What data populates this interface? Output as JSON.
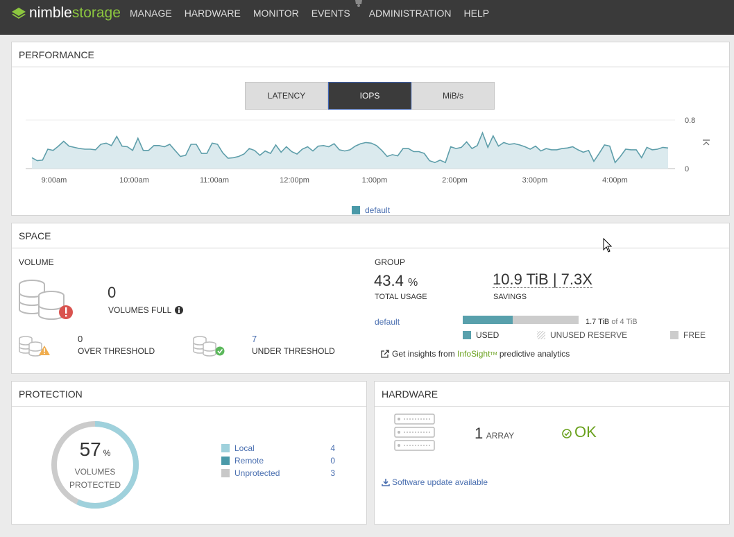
{
  "app": {
    "brand_a": "nimble",
    "brand_b": "storage"
  },
  "nav": [
    "MANAGE",
    "HARDWARE",
    "MONITOR",
    "EVENTS",
    "ADMINISTRATION",
    "HELP"
  ],
  "performance": {
    "title": "PERFORMANCE",
    "tabs": [
      "LATENCY",
      "IOPS",
      "MiB/s"
    ],
    "active_tab": "IOPS",
    "legend": "default",
    "chart_data": {
      "type": "area",
      "x_ticks": [
        "9:00am",
        "10:00am",
        "11:00am",
        "12:00pm",
        "1:00pm",
        "2:00pm",
        "3:00pm",
        "4:00pm"
      ],
      "y_ticks": [
        "0.8",
        "0"
      ],
      "ylim": [
        0,
        0.8
      ],
      "series": [
        {
          "name": "default",
          "color": "#5e9eaa",
          "values": [
            0.18,
            0.13,
            0.14,
            0.32,
            0.3,
            0.37,
            0.45,
            0.37,
            0.35,
            0.33,
            0.32,
            0.32,
            0.31,
            0.4,
            0.42,
            0.38,
            0.53,
            0.37,
            0.36,
            0.3,
            0.5,
            0.3,
            0.3,
            0.38,
            0.38,
            0.36,
            0.4,
            0.3,
            0.2,
            0.22,
            0.4,
            0.4,
            0.25,
            0.25,
            0.42,
            0.4,
            0.26,
            0.17,
            0.18,
            0.2,
            0.24,
            0.33,
            0.3,
            0.22,
            0.29,
            0.25,
            0.39,
            0.27,
            0.36,
            0.28,
            0.24,
            0.32,
            0.36,
            0.29,
            0.37,
            0.38,
            0.36,
            0.41,
            0.31,
            0.29,
            0.31,
            0.37,
            0.41,
            0.43,
            0.42,
            0.38,
            0.3,
            0.2,
            0.23,
            0.21,
            0.33,
            0.33,
            0.28,
            0.28,
            0.25,
            0.13,
            0.1,
            0.14,
            0.1,
            0.36,
            0.33,
            0.35,
            0.44,
            0.33,
            0.38,
            0.59,
            0.35,
            0.54,
            0.37,
            0.43,
            0.4,
            0.41,
            0.39,
            0.36,
            0.32,
            0.37,
            0.29,
            0.33,
            0.31,
            0.31,
            0.33,
            0.34,
            0.36,
            0.31,
            0.27,
            0.3,
            0.12,
            0.25,
            0.39,
            0.37,
            0.1,
            0.2,
            0.32,
            0.31,
            0.31,
            0.18,
            0.35,
            0.31,
            0.32,
            0.35,
            0.34
          ]
        }
      ]
    }
  },
  "space": {
    "title": "SPACE",
    "volume_title": "VOLUME",
    "volumes_full": "0",
    "volumes_full_label": "VOLUMES FULL",
    "over_threshold": "0",
    "over_threshold_label": "OVER THRESHOLD",
    "under_threshold": "7",
    "under_threshold_label": "UNDER THRESHOLD",
    "group_title": "GROUP",
    "total_usage": "43.4",
    "total_usage_unit": "%",
    "total_usage_label": "TOTAL USAGE",
    "savings": "10.9 TiB | 7.3X",
    "savings_label": "SAVINGS",
    "pool": "default",
    "pool_usage_fraction": 0.43,
    "pool_usage_text_used": "1.7 TiB",
    "pool_usage_text_of": "of 4 TiB",
    "legend_used": "USED",
    "legend_reserve": "UNUSED RESERVE",
    "legend_free": "FREE",
    "insight_prefix": "Get insights from",
    "insight_brand": "InfoSight",
    "insight_tm": "TM",
    "insight_suffix": "predictive analytics",
    "colors": {
      "used": "#58a0ac",
      "free": "#cccccc"
    }
  },
  "protection": {
    "title": "PROTECTION",
    "percent": "57",
    "percent_unit": "%",
    "percent_value": 57,
    "label1": "VOLUMES",
    "label2": "PROTECTED",
    "rows": [
      {
        "label": "Local",
        "count": "4",
        "color": "#9fd1dc"
      },
      {
        "label": "Remote",
        "count": "0",
        "color": "#4a99a8"
      },
      {
        "label": "Unprotected",
        "count": "3",
        "color": "#c8c8c8"
      }
    ]
  },
  "hardware": {
    "title": "HARDWARE",
    "array_count": "1",
    "array_label": "ARRAY",
    "status": "OK",
    "update": "Software update available"
  }
}
